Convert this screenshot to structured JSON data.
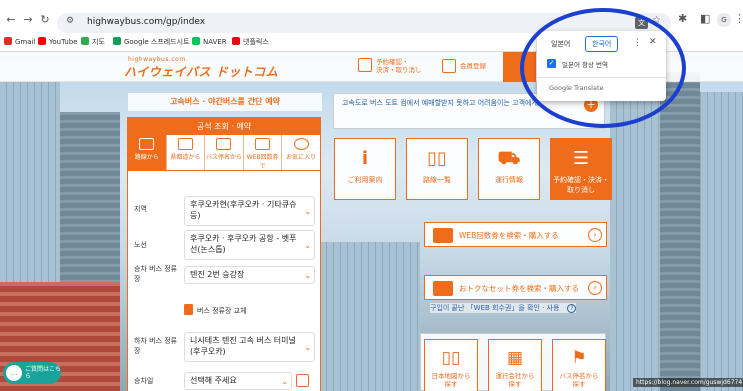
{
  "browser": {
    "url": "highwaybus.com/gp/index",
    "avatar_letter": "G",
    "bookmarks": [
      {
        "label": "Gmail",
        "color": "#d93025"
      },
      {
        "label": "YouTube",
        "color": "#ff0000"
      },
      {
        "label": "지도",
        "color": "#34a853"
      },
      {
        "label": "Google 스프레드시트",
        "color": "#0f9d58"
      },
      {
        "label": "NAVER",
        "color": "#03c75a"
      },
      {
        "label": "넷플릭스",
        "color": "#e50914"
      }
    ]
  },
  "translate_popup": {
    "lang_source": "일본어",
    "lang_target": "한국어",
    "always_translate": "일본어 항상 번역",
    "footer": "Google Translate"
  },
  "site": {
    "logo_small": "highwaybus.com",
    "logo_main": "ハイウェイバス ドットコム",
    "nav_reservation": "予約確認・\n決済・取り消し",
    "nav_member": "会員登録"
  },
  "banner": "고속버스 · 야간버스를 간단 예약",
  "search": {
    "title": "공석 조회 · 예약",
    "tabs": [
      "路線から",
      "県都道から",
      "バス停名から",
      "WEB回数券で",
      "お気に入り"
    ],
    "route_label": "지역",
    "route_value": "후쿠오카현(후쿠오카 · 기타큐슈 등)",
    "line_label": "노선",
    "line_value": "후쿠오카 · 후쿠오카 공항 - 벳푸선(논스톱)",
    "board_label": "승차 버스 정류장",
    "board_value": "텐진 2번 승강장",
    "swap_label": "버스 정류장 교체",
    "alight_label": "하차 버스 정류장",
    "alight_value": "니시테츠 텐진 고속 버스 터미널(후쿠오카)",
    "date_label": "승차일",
    "date_value": "선택해 주세요"
  },
  "info": {
    "text": "고속도로 버스 도트 컴에서 예매할받지 못하고 어려움이는 고객에게"
  },
  "tiles": [
    {
      "label": "ご利用案内",
      "icon": "i"
    },
    {
      "label": "路線一覧",
      "icon": "▯▯"
    },
    {
      "label": "運行情報",
      "icon": "⛟"
    },
    {
      "label": "予約確認・決済・\n取り消し",
      "icon": "☰"
    }
  ],
  "links": {
    "web_ticket": "WEB回数券を検索・購入する",
    "note": "구입이 끝난 「WEB 회수권」을 확인 · 사용",
    "set_ticket": "おトクなセット券を検索・購入する"
  },
  "bottom_tiles": [
    {
      "label": "日本地図から\n探す",
      "icon": "▯▯"
    },
    {
      "label": "運行会社から\n探す",
      "icon": "▦"
    },
    {
      "label": "バス停名から\n探す",
      "icon": "⚑"
    }
  ],
  "chat": "ご質問はこちら",
  "watermark": "https://blog.naver.com/guswjd6774"
}
